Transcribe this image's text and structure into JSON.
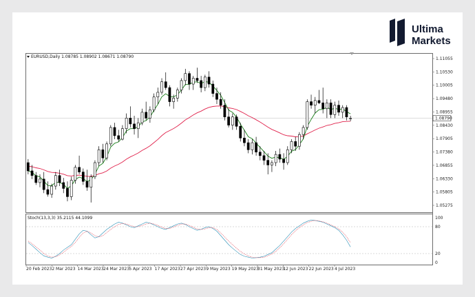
{
  "brand": {
    "name_line1": "Ultima",
    "name_line2": "Markets",
    "color": "#121a30"
  },
  "chart_data": [
    {
      "type": "candlestick",
      "header": "EURUSD,Daily  1.08785 1.08902 1.08671 1.08790",
      "symbol": "EURUSD",
      "timeframe": "Daily",
      "ohlc_last": [
        1.08785,
        1.08902,
        1.08671,
        1.0879
      ],
      "current_price_label": "1.08790",
      "ylim": [
        1.0502,
        1.1125
      ],
      "yticks": [
        "1.11055",
        "1.10530",
        "1.10005",
        "1.09480",
        "1.08955",
        "1.08430",
        "1.07905",
        "1.07380",
        "1.06855",
        "1.06330",
        "1.05805",
        "1.05275"
      ],
      "xticks": [
        "20 Feb 2023",
        "2 Mar 2023",
        "14 Mar 2023",
        "24 Mar 2023",
        "5 Apr 2023",
        "17 Apr 2023",
        "27 Apr 2023",
        "9 May 2023",
        "19 May 2023",
        "31 May 2023",
        "12 Jun 2023",
        "22 Jun 2023",
        "4 Jul 2023"
      ],
      "candles": [
        [
          1.069,
          1.0705,
          1.064,
          1.0655
        ],
        [
          1.0655,
          1.068,
          1.062,
          1.0635
        ],
        [
          1.0635,
          1.065,
          1.0595,
          1.0605
        ],
        [
          1.0605,
          1.064,
          1.0585,
          1.062
        ],
        [
          1.062,
          1.065,
          1.056,
          1.0575
        ],
        [
          1.0575,
          1.061,
          1.0545,
          1.0555
        ],
        [
          1.0555,
          1.06,
          1.054,
          1.059
        ],
        [
          1.059,
          1.065,
          1.0575,
          1.0635
        ],
        [
          1.0635,
          1.066,
          1.059,
          1.0605
        ],
        [
          1.0605,
          1.0625,
          1.056,
          1.058
        ],
        [
          1.058,
          1.061,
          1.0525,
          1.0545
        ],
        [
          1.0545,
          1.063,
          1.053,
          1.0615
        ],
        [
          1.0615,
          1.068,
          1.06,
          1.067
        ],
        [
          1.067,
          1.072,
          1.064,
          1.065
        ],
        [
          1.065,
          1.0665,
          1.0595,
          1.061
        ],
        [
          1.061,
          1.066,
          1.057,
          1.0585
        ],
        [
          1.0585,
          1.064,
          1.052,
          1.063
        ],
        [
          1.063,
          1.07,
          1.062,
          1.069
        ],
        [
          1.069,
          1.076,
          1.0675,
          1.0745
        ],
        [
          1.0745,
          1.077,
          1.069,
          1.071
        ],
        [
          1.071,
          1.078,
          1.07,
          1.077
        ],
        [
          1.077,
          1.085,
          1.076,
          1.084
        ],
        [
          1.084,
          1.086,
          1.079,
          1.0805
        ],
        [
          1.0805,
          1.083,
          1.078,
          1.079
        ],
        [
          1.079,
          1.085,
          1.0785,
          1.0835
        ],
        [
          1.0835,
          1.09,
          1.0815,
          1.088
        ],
        [
          1.088,
          1.093,
          1.084,
          1.0855
        ],
        [
          1.0855,
          1.089,
          1.081,
          1.0835
        ],
        [
          1.0835,
          1.088,
          1.0795,
          1.086
        ],
        [
          1.086,
          1.092,
          1.085,
          1.0905
        ],
        [
          1.0905,
          1.095,
          1.087,
          1.088
        ],
        [
          1.088,
          1.093,
          1.086,
          1.0915
        ],
        [
          1.0915,
          1.0985,
          1.0905,
          1.097
        ],
        [
          1.097,
          1.101,
          1.094,
          1.099
        ],
        [
          1.099,
          1.105,
          1.098,
          1.1035
        ],
        [
          1.1035,
          1.1075,
          1.1,
          1.101
        ],
        [
          1.101,
          1.102,
          1.093,
          1.095
        ],
        [
          1.095,
          1.098,
          1.092,
          1.0965
        ],
        [
          1.0965,
          1.101,
          1.095,
          1.1
        ],
        [
          1.1,
          1.105,
          1.0985,
          1.104
        ],
        [
          1.104,
          1.109,
          1.102,
          1.107
        ],
        [
          1.107,
          1.108,
          1.1,
          1.1025
        ],
        [
          1.1025,
          1.106,
          1.1,
          1.105
        ],
        [
          1.105,
          1.1095,
          1.103,
          1.104
        ],
        [
          1.104,
          1.106,
          1.099,
          1.101
        ],
        [
          1.101,
          1.1065,
          1.0995,
          1.1055
        ],
        [
          1.1055,
          1.108,
          1.101,
          1.1025
        ],
        [
          1.1025,
          1.104,
          1.097,
          1.0985
        ],
        [
          1.0985,
          1.101,
          1.094,
          1.096
        ],
        [
          1.096,
          1.099,
          1.092,
          1.0935
        ],
        [
          1.0935,
          1.096,
          1.087,
          1.0885
        ],
        [
          1.0885,
          1.092,
          1.084,
          1.085
        ],
        [
          1.085,
          1.09,
          1.083,
          1.0885
        ],
        [
          1.0885,
          1.0895,
          1.083,
          1.0845
        ],
        [
          1.0845,
          1.086,
          1.078,
          1.0795
        ],
        [
          1.0795,
          1.083,
          1.076,
          1.0775
        ],
        [
          1.0775,
          1.079,
          1.073,
          1.0745
        ],
        [
          1.0745,
          1.079,
          1.0725,
          1.0775
        ],
        [
          1.0775,
          1.08,
          1.072,
          1.0735
        ],
        [
          1.0735,
          1.076,
          1.07,
          1.072
        ],
        [
          1.072,
          1.074,
          1.068,
          1.07
        ],
        [
          1.07,
          1.073,
          1.064,
          1.068
        ],
        [
          1.068,
          1.07,
          1.065,
          1.069
        ],
        [
          1.069,
          1.074,
          1.0675,
          1.0725
        ],
        [
          1.0725,
          1.075,
          1.069,
          1.0705
        ],
        [
          1.0705,
          1.073,
          1.066,
          1.069
        ],
        [
          1.069,
          1.076,
          1.068,
          1.0745
        ],
        [
          1.0745,
          1.079,
          1.073,
          1.078
        ],
        [
          1.078,
          1.08,
          1.074,
          1.076
        ],
        [
          1.076,
          1.082,
          1.0745,
          1.081
        ],
        [
          1.081,
          1.085,
          1.079,
          1.084
        ],
        [
          1.084,
          1.096,
          1.083,
          1.095
        ],
        [
          1.095,
          1.098,
          1.092,
          1.0935
        ],
        [
          1.0935,
          1.097,
          1.09,
          1.0955
        ],
        [
          1.0955,
          1.1,
          1.094,
          1.0945
        ],
        [
          1.0945,
          1.101,
          1.09,
          1.092
        ],
        [
          1.092,
          1.096,
          1.088,
          1.0945
        ],
        [
          1.0945,
          1.096,
          1.088,
          1.0895
        ],
        [
          1.0895,
          1.095,
          1.088,
          1.0935
        ],
        [
          1.0935,
          1.0955,
          1.089,
          1.0905
        ],
        [
          1.0905,
          1.0935,
          1.088,
          1.0925
        ],
        [
          1.0925,
          1.0935,
          1.087,
          1.0885
        ],
        [
          1.0879,
          1.089,
          1.0867,
          1.0879
        ]
      ],
      "overlays": [
        {
          "name": "fast-ma",
          "color": "#1a7f1a"
        },
        {
          "name": "slow-ma",
          "color": "#e0204a"
        }
      ],
      "price_line_color": "#c8c8c8"
    },
    {
      "type": "line",
      "header": "Stoch(13,3,3) 35.2115 44.1099",
      "indicator": "Stoch(13,3,3)",
      "values_last": [
        35.2115,
        44.1099
      ],
      "ylim": [
        0,
        100
      ],
      "yticks": [
        "100",
        "80",
        "20",
        "0"
      ],
      "levels": [
        80,
        20
      ],
      "series": [
        {
          "color": "#2a8fb6",
          "values": [
            45,
            38,
            30,
            22,
            15,
            12,
            10,
            14,
            20,
            28,
            34,
            40,
            52,
            64,
            72,
            70,
            62,
            55,
            58,
            66,
            74,
            80,
            86,
            90,
            88,
            84,
            80,
            78,
            82,
            86,
            90,
            88,
            84,
            80,
            76,
            74,
            78,
            82,
            86,
            88,
            85,
            80,
            76,
            72,
            74,
            78,
            80,
            76,
            70,
            60,
            50,
            40,
            32,
            25,
            18,
            14,
            12,
            10,
            11,
            12,
            14,
            18,
            22,
            30,
            38,
            48,
            58,
            68,
            76,
            82,
            88,
            92,
            95,
            94,
            92,
            90,
            86,
            82,
            78,
            72,
            62,
            50,
            35
          ]
        },
        {
          "color": "#e04a5a",
          "values": [
            48,
            42,
            35,
            28,
            20,
            15,
            12,
            13,
            17,
            23,
            30,
            36,
            45,
            56,
            66,
            70,
            66,
            60,
            57,
            60,
            67,
            74,
            80,
            85,
            87,
            86,
            83,
            80,
            80,
            83,
            86,
            88,
            86,
            83,
            79,
            76,
            76,
            79,
            83,
            86,
            86,
            83,
            79,
            75,
            74,
            75,
            78,
            78,
            74,
            66,
            57,
            48,
            40,
            32,
            25,
            19,
            15,
            12,
            11,
            11,
            12,
            15,
            19,
            25,
            33,
            42,
            52,
            62,
            71,
            78,
            84,
            89,
            92,
            94,
            93,
            91,
            88,
            84,
            80,
            75,
            68,
            58,
            44
          ]
        }
      ]
    }
  ]
}
